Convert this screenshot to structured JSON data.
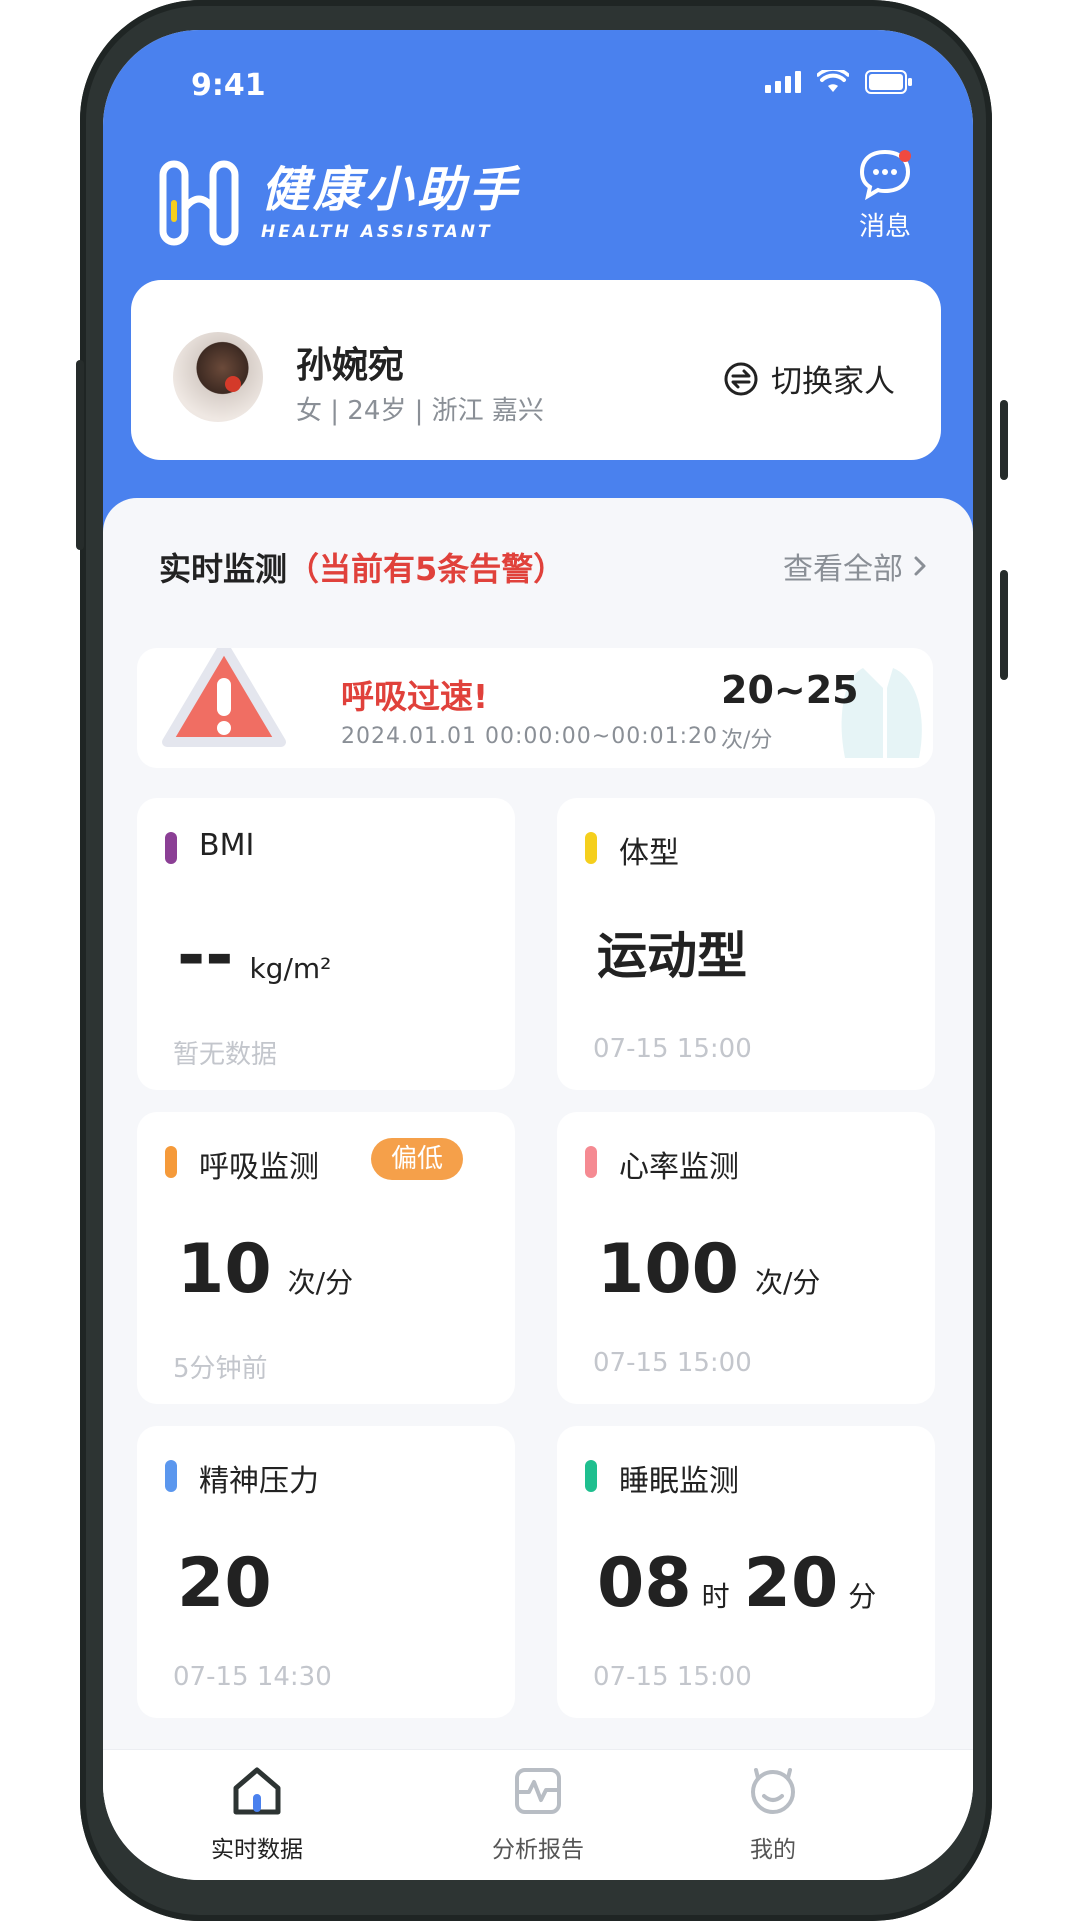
{
  "status_bar": {
    "time": "9:41"
  },
  "app": {
    "name_cn": "健康小助手",
    "name_en": "HEALTH ASSISTANT"
  },
  "header": {
    "message_label": "消息",
    "message_has_unread": true
  },
  "profile": {
    "name": "孙婉宛",
    "info": "女 | 24岁 | 浙江 嘉兴",
    "switch_label": "切换家人"
  },
  "monitor": {
    "title": "实时监测",
    "alert_summary": "（当前有5条告警）",
    "view_all": "查看全部"
  },
  "alert": {
    "title": "呼吸过速!",
    "time_range": "2024.01.01  00:00:00~00:01:20",
    "value": "20~25",
    "unit": "次/分"
  },
  "cards": {
    "bmi": {
      "title": "BMI",
      "value": "--",
      "unit": "kg/m²",
      "time": "暂无数据",
      "color": "#8b3f95"
    },
    "body_type": {
      "title": "体型",
      "value": "运动型",
      "time": "07-15 15:00",
      "color": "#f5cf1d"
    },
    "breath": {
      "title": "呼吸监测",
      "badge": "偏低",
      "value": "10",
      "unit": "次/分",
      "time": "5分钟前",
      "color": "#f59a3a"
    },
    "heart": {
      "title": "心率监测",
      "value": "100",
      "unit": "次/分",
      "time": "07-15 15:00",
      "color": "#f58a92"
    },
    "stress": {
      "title": "精神压力",
      "value": "20",
      "time": "07-15 14:30",
      "color": "#5b97ee"
    },
    "sleep": {
      "title": "睡眠监测",
      "hours": "08",
      "hours_unit": "时",
      "minutes": "20",
      "minutes_unit": "分",
      "time": "07-15 15:00",
      "color": "#1fbf8f"
    }
  },
  "tabbar": {
    "items": [
      {
        "label": "实时数据",
        "icon": "home-icon",
        "active": true
      },
      {
        "label": "分析报告",
        "icon": "report-icon",
        "active": false
      },
      {
        "label": "我的",
        "icon": "profile-icon",
        "active": false
      }
    ]
  }
}
